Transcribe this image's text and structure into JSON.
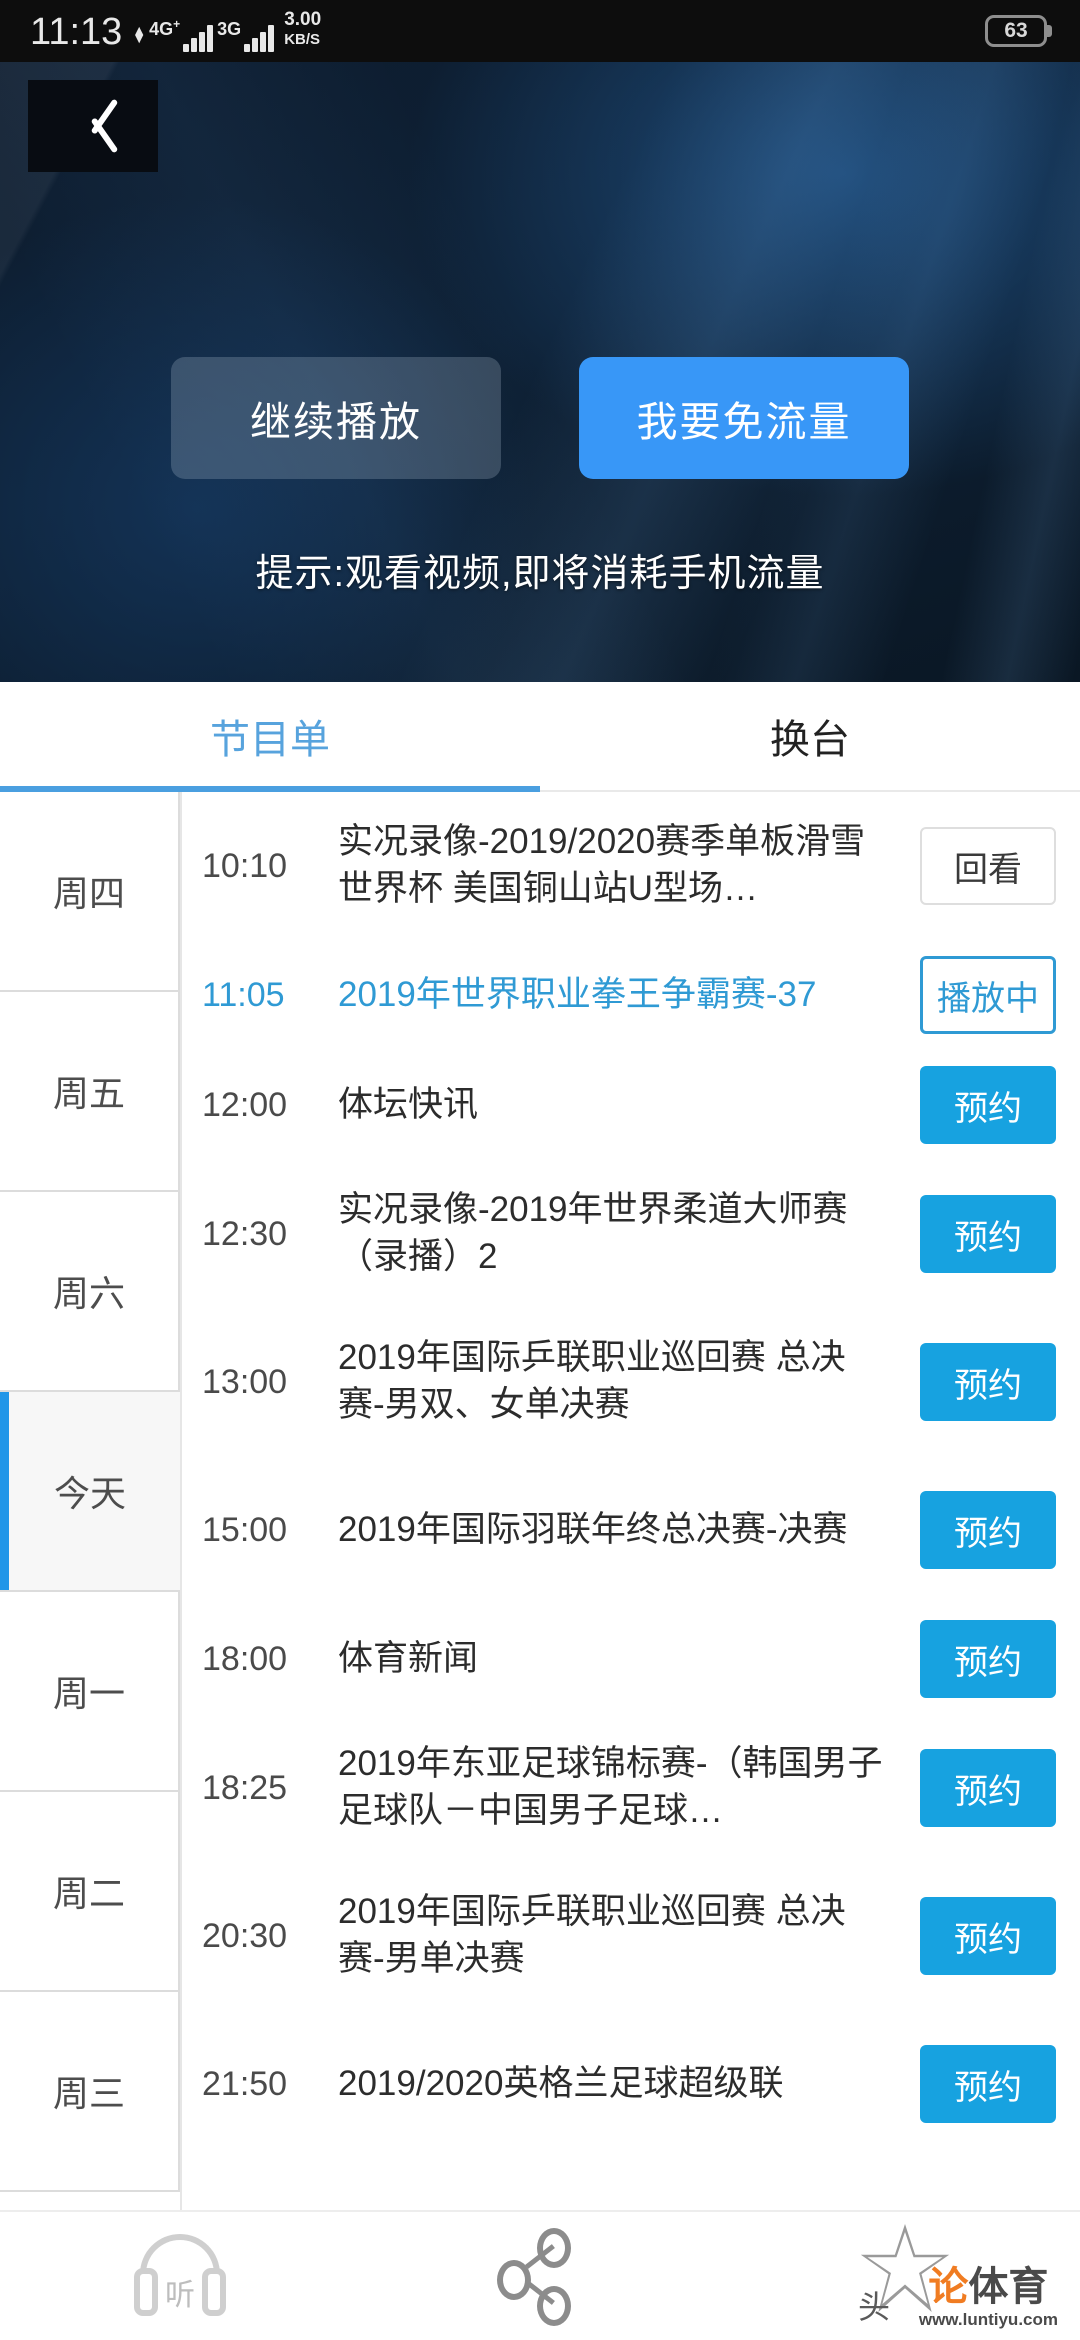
{
  "status_bar": {
    "time": "11:13",
    "network_primary": "4G",
    "network_primary_sup": "+",
    "network_secondary": "3G",
    "speed_value": "3.00",
    "speed_unit": "KB/S",
    "battery_level": "63"
  },
  "player": {
    "back_icon": "chevron-left-icon",
    "continue_label": "继续播放",
    "free_data_label": "我要免流量",
    "hint": "提示:观看视频,即将消耗手机流量",
    "accent_color": "#3897f7"
  },
  "tabs": [
    {
      "label": "节目单",
      "active": true
    },
    {
      "label": "换台",
      "active": false
    }
  ],
  "days": [
    {
      "label": "周四",
      "active": false
    },
    {
      "label": "周五",
      "active": false
    },
    {
      "label": "周六",
      "active": false
    },
    {
      "label": "今天",
      "active": true
    },
    {
      "label": "周一",
      "active": false
    },
    {
      "label": "周二",
      "active": false
    },
    {
      "label": "周三",
      "active": false
    }
  ],
  "programs": [
    {
      "time": "10:10",
      "title": "实况录像-2019/2020赛季单板滑雪世界杯 美国铜山站U型场…",
      "action": "回看",
      "state": "replay"
    },
    {
      "time": "11:05",
      "title": "2019年世界职业拳王争霸赛-37",
      "action": "播放中",
      "state": "live"
    },
    {
      "time": "12:00",
      "title": "体坛快讯",
      "action": "预约",
      "state": "book"
    },
    {
      "time": "12:30",
      "title": "实况录像-2019年世界柔道大师赛（录播）2",
      "action": "预约",
      "state": "book"
    },
    {
      "time": "13:00",
      "title": "2019年国际乒联职业巡回赛 总决赛-男双、女单决赛",
      "action": "预约",
      "state": "book"
    },
    {
      "time": "15:00",
      "title": "2019年国际羽联年终总决赛-决赛",
      "action": "预约",
      "state": "book"
    },
    {
      "time": "18:00",
      "title": "体育新闻",
      "action": "预约",
      "state": "book"
    },
    {
      "time": "18:25",
      "title": "2019年东亚足球锦标赛-（韩国男子足球队－中国男子足球…",
      "action": "预约",
      "state": "book"
    },
    {
      "time": "20:30",
      "title": "2019年国际乒联职业巡回赛 总决赛-男单决赛",
      "action": "预约",
      "state": "book"
    },
    {
      "time": "21:50",
      "title": "2019/2020英格兰足球超级联",
      "action": "预约",
      "state": "book"
    }
  ],
  "bottom_bar": {
    "listen_label": "听",
    "favorite_label": "头",
    "watermark_brand_1": "论",
    "watermark_brand_2": "体育",
    "watermark_url": "www.luntiyu.com",
    "brand_color": "#f07c22"
  }
}
